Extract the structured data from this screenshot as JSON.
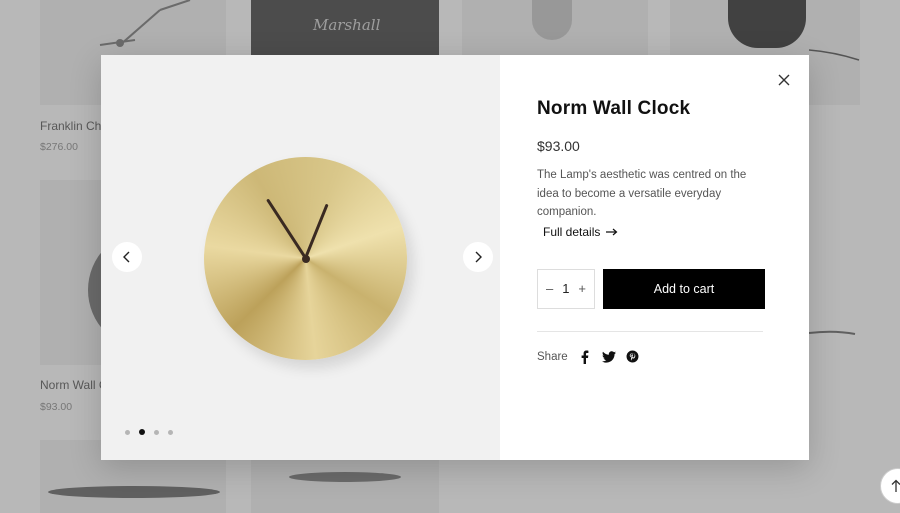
{
  "background": {
    "products": [
      {
        "name": "Franklin Cha",
        "price": "$276.00"
      },
      {
        "name": "Norm Wall C",
        "price": "$93.00"
      }
    ],
    "brand_badge": "Marshall"
  },
  "modal": {
    "title": "Norm Wall Clock",
    "price": "$93.00",
    "description": "The Lamp's aesthetic was centred on the idea to become a versatile everyday companion.",
    "full_details_label": "Full details",
    "quantity": "1",
    "qty_minus": "–",
    "qty_plus": "+",
    "add_to_cart_label": "Add to cart",
    "share_label": "Share",
    "gallery": {
      "slide_count": 4,
      "active_slide": 2
    },
    "icons": {
      "close": "close-icon",
      "prev": "chevron-left-icon",
      "next": "chevron-right-icon",
      "arrow": "arrow-right-icon",
      "share": [
        "facebook-icon",
        "twitter-icon",
        "pinterest-icon"
      ]
    }
  },
  "colors": {
    "accent": "#000000",
    "clock_brass": "#d9c78a"
  }
}
